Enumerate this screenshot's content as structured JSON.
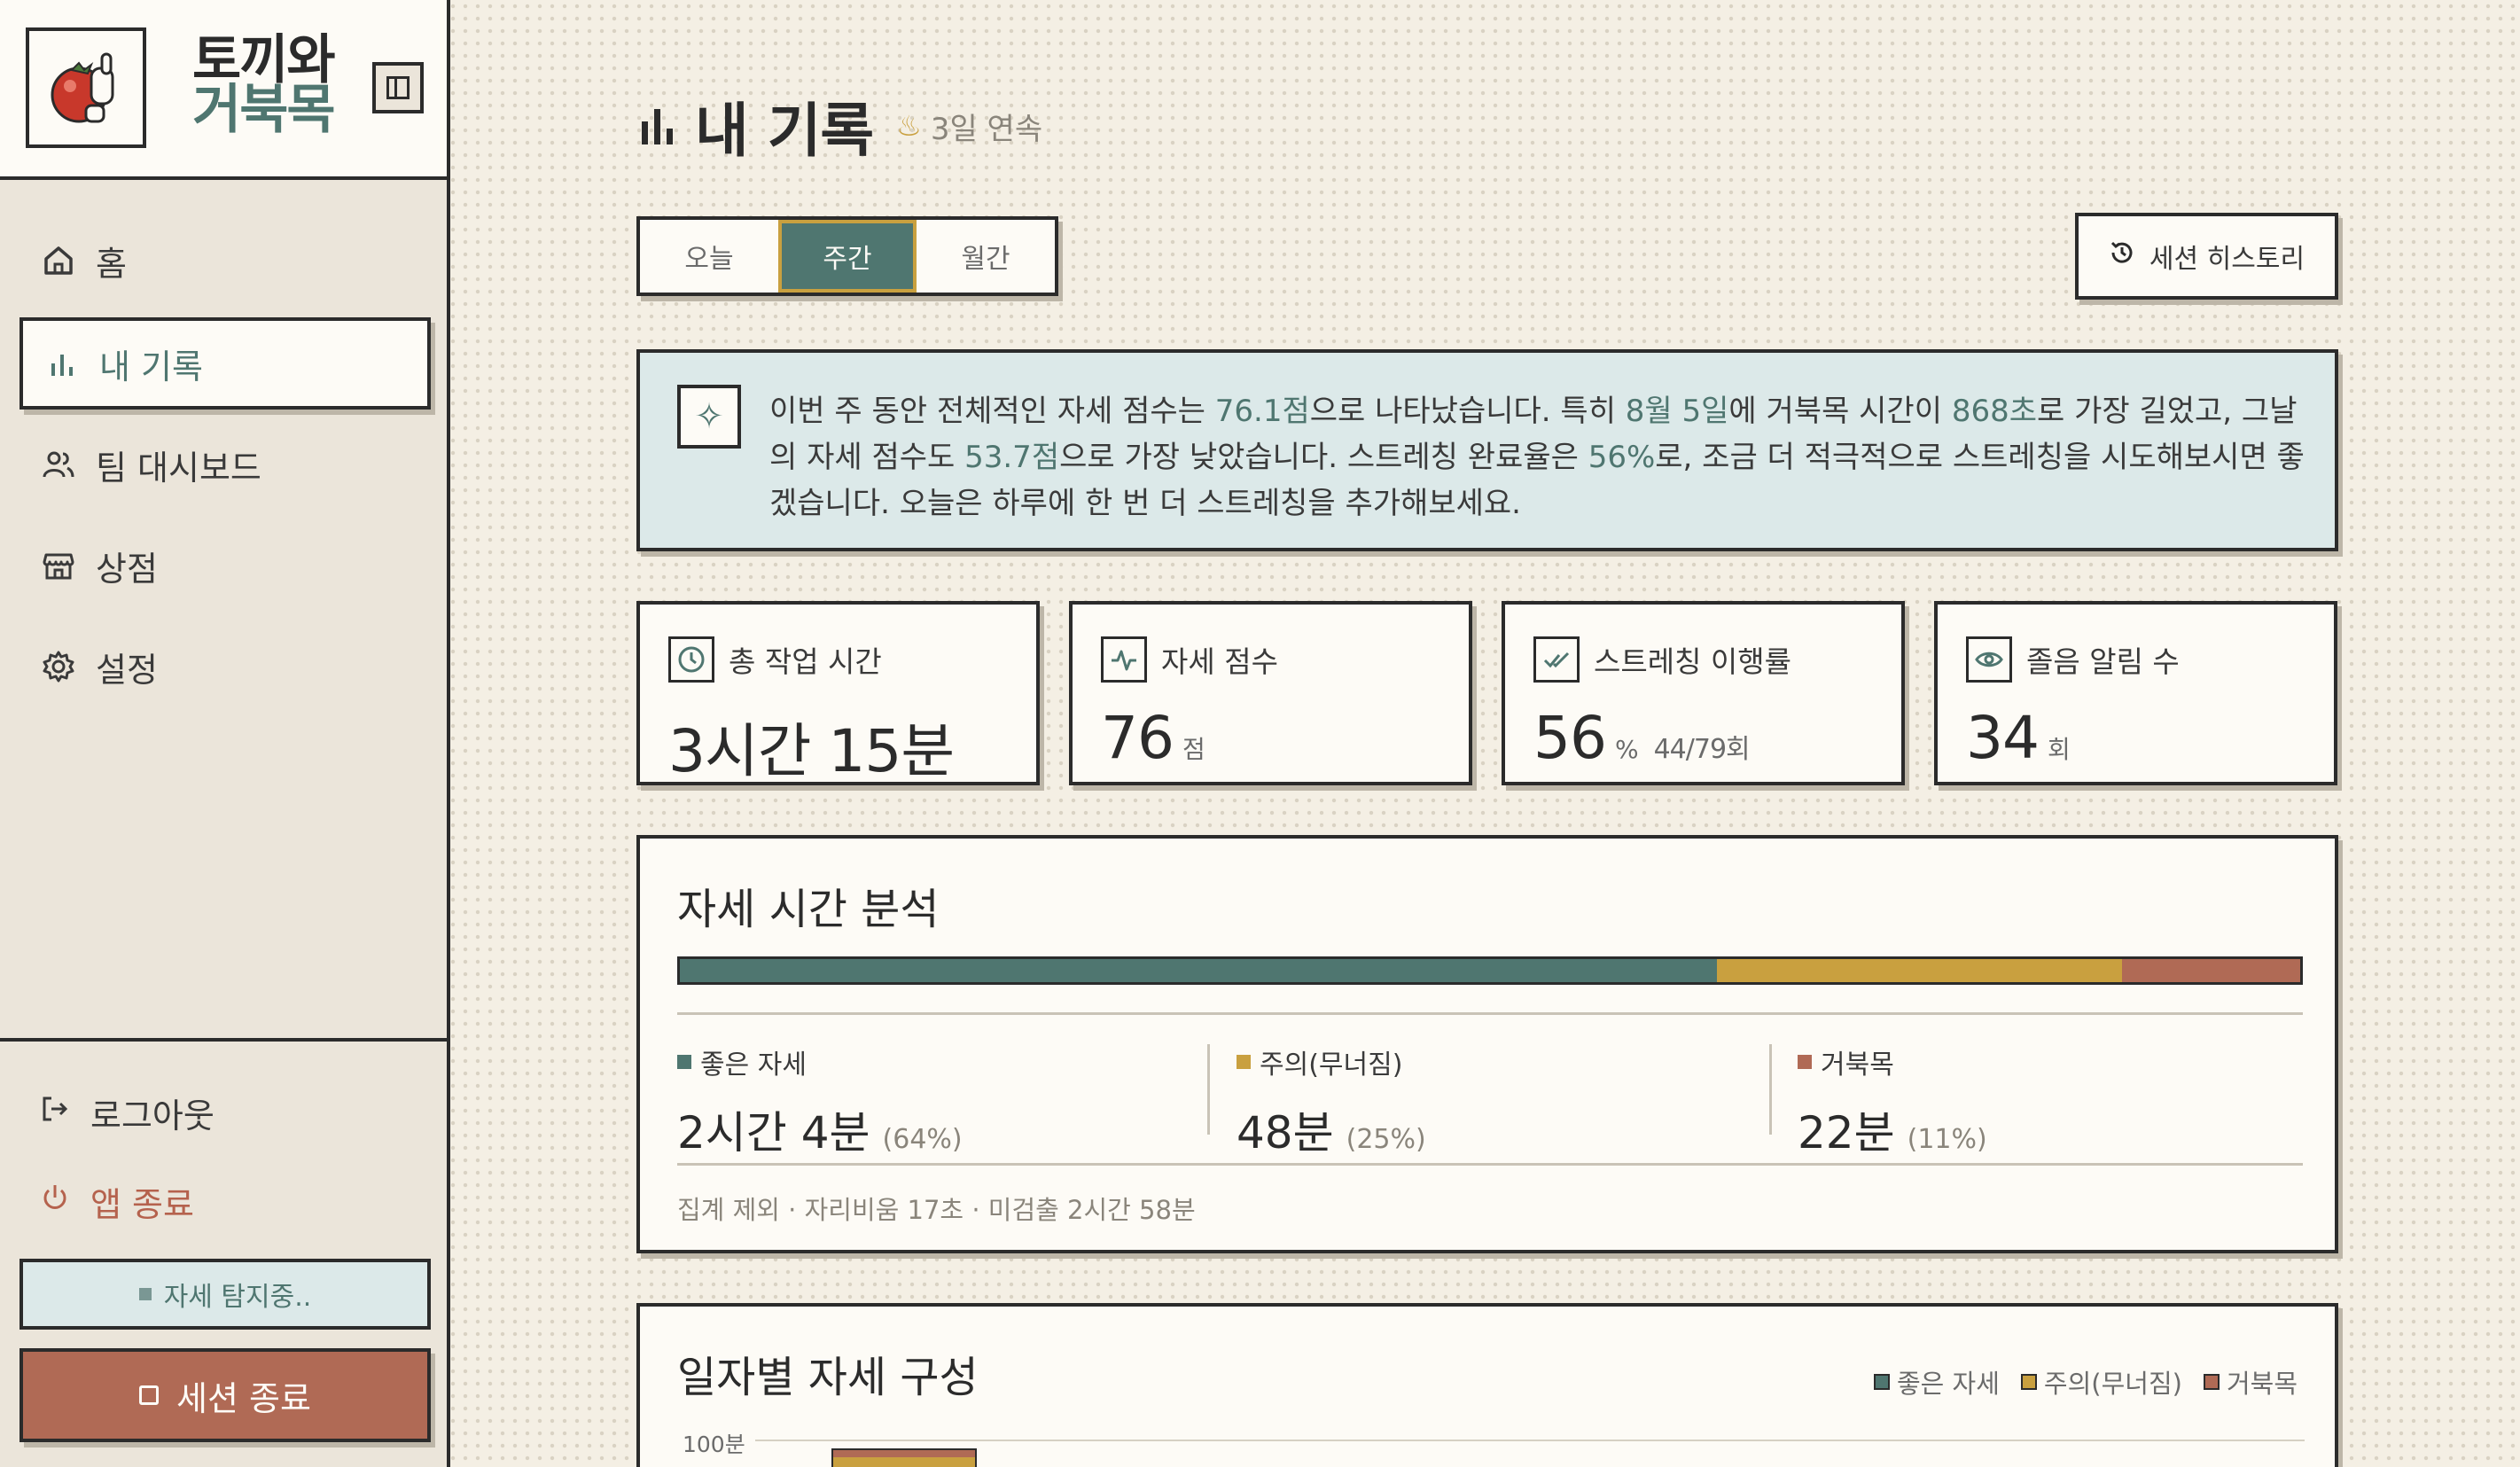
{
  "app": {
    "title_line1": "토끼와",
    "title_line2": "거북목"
  },
  "sidebar": {
    "items": [
      {
        "label": "홈",
        "icon": "home-icon"
      },
      {
        "label": "내 기록",
        "icon": "bar-chart-icon",
        "active": true
      },
      {
        "label": "팀 대시보드",
        "icon": "users-icon"
      },
      {
        "label": "상점",
        "icon": "store-icon"
      },
      {
        "label": "설정",
        "icon": "gear-icon"
      }
    ],
    "logout_label": "로그아웃",
    "quit_label": "앱 종료",
    "detect_status": "자세 탐지중..",
    "end_session_label": "세션 종료"
  },
  "header": {
    "title": "내 기록",
    "streak": "3일 연속"
  },
  "tabs": [
    {
      "label": "오늘"
    },
    {
      "label": "주간",
      "active": true
    },
    {
      "label": "월간"
    }
  ],
  "history_button": "세션 히스토리",
  "insight": {
    "t1": "이번 주 동안 전체적인 자세 점수는 ",
    "h1": "76.1점",
    "t2": "으로 나타났습니다. 특히 ",
    "h2": "8월 5일",
    "t3": "에 거북목 시간이 ",
    "h3": "868초",
    "t4": "로 가장 길었고, 그날의 자세 점수도 ",
    "h4": "53.7점",
    "t5": "으로 가장 낮았습니다. 스트레칭 완료율은 ",
    "h5": "56%",
    "t6": "로, 조금 더 적극적으로 스트레칭을 시도해보시면 좋겠습니다. 오늘은 하루에 한 번 더 스트레칭을 추가해보세요."
  },
  "stats": [
    {
      "label": "총 작업 시간",
      "icon": "clock-icon",
      "value": "3시간 15분",
      "unit": "",
      "sub": ""
    },
    {
      "label": "자세 점수",
      "icon": "pulse-icon",
      "value": "76",
      "unit": "점",
      "sub": ""
    },
    {
      "label": "스트레칭 이행률",
      "icon": "check-icon",
      "value": "56",
      "unit": "%",
      "sub": "44/79회"
    },
    {
      "label": "졸음 알림 수",
      "icon": "eye-icon",
      "value": "34",
      "unit": "회",
      "sub": ""
    }
  ],
  "posture_analysis": {
    "title": "자세 시간 분석",
    "colors": {
      "good": "#4f7670",
      "warn": "#c9a03f",
      "bad": "#b06a55"
    },
    "segments": [
      {
        "label": "좋은 자세",
        "value": "2시간 4분",
        "pct": "(64%)",
        "fraction": 0.64
      },
      {
        "label": "주의(무너짐)",
        "value": "48분",
        "pct": "(25%)",
        "fraction": 0.25
      },
      {
        "label": "거북목",
        "value": "22분",
        "pct": "(11%)",
        "fraction": 0.11
      }
    ],
    "footer": "집계 제외 · 자리비움 17초 · 미검출 2시간 58분"
  },
  "daily": {
    "title": "일자별 자세 구성",
    "legend": [
      "좋은 자세",
      "주의(무너짐)",
      "거북목"
    ],
    "ytick": "100분"
  }
}
